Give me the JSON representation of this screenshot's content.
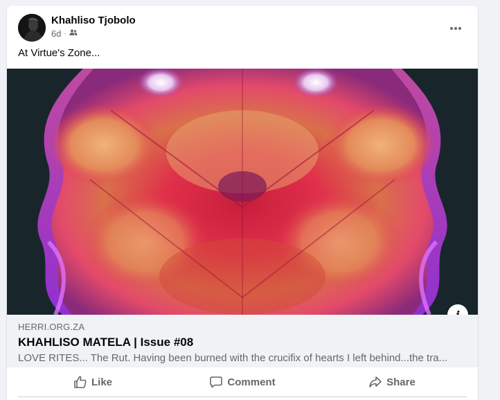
{
  "post": {
    "author": "Khahliso Tjobolo",
    "time": "6d",
    "separator": "·",
    "audience_icon": "friends-icon",
    "text": "At Virtue's Zone..."
  },
  "link_preview": {
    "domain": "HERRI.ORG.ZA",
    "title": "KHAHLISO MATELA | Issue #08",
    "description": "LOVE RITES... The Rut. Having been burned with the crucifix of hearts I left behind...the tra..."
  },
  "actions": {
    "like": "Like",
    "comment": "Comment",
    "share": "Share"
  },
  "icons": {
    "more": "more-icon",
    "info": "i",
    "like": "thumbs-up-icon",
    "comment": "comment-icon",
    "share": "share-icon"
  },
  "colors": {
    "background": "#f0f2f5",
    "text_primary": "#050505",
    "text_secondary": "#65676b",
    "divider": "#ced0d4"
  }
}
